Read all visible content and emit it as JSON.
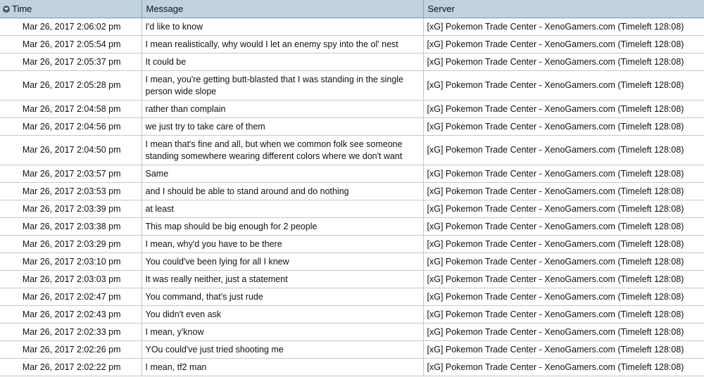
{
  "columns": {
    "time": "Time",
    "message": "Message",
    "server": "Server"
  },
  "rows": [
    {
      "time": "Mar 26, 2017 2:06:02 pm",
      "message": "I'd like to know",
      "server": "[xG] Pokemon Trade Center - XenoGamers.com (Timeleft 128:08)"
    },
    {
      "time": "Mar 26, 2017 2:05:54 pm",
      "message": "I mean realistically, why would I let an enemy spy into the ol' nest",
      "server": "[xG] Pokemon Trade Center - XenoGamers.com (Timeleft 128:08)"
    },
    {
      "time": "Mar 26, 2017 2:05:37 pm",
      "message": "It could be",
      "server": "[xG] Pokemon Trade Center - XenoGamers.com (Timeleft 128:08)"
    },
    {
      "time": "Mar 26, 2017 2:05:28 pm",
      "message": "I mean, you're getting butt-blasted that I was standing in the single person wide slope",
      "server": "[xG] Pokemon Trade Center - XenoGamers.com (Timeleft 128:08)"
    },
    {
      "time": "Mar 26, 2017 2:04:58 pm",
      "message": "rather than complain",
      "server": "[xG] Pokemon Trade Center - XenoGamers.com (Timeleft 128:08)"
    },
    {
      "time": "Mar 26, 2017 2:04:56 pm",
      "message": "we just try to take care of them",
      "server": "[xG] Pokemon Trade Center - XenoGamers.com (Timeleft 128:08)"
    },
    {
      "time": "Mar 26, 2017 2:04:50 pm",
      "message": "I mean that's fine and all, but when we common folk see someone standing somewhere wearing different colors where we don't want",
      "server": "[xG] Pokemon Trade Center - XenoGamers.com (Timeleft 128:08)"
    },
    {
      "time": "Mar 26, 2017 2:03:57 pm",
      "message": "Same",
      "server": "[xG] Pokemon Trade Center - XenoGamers.com (Timeleft 128:08)"
    },
    {
      "time": "Mar 26, 2017 2:03:53 pm",
      "message": "and I should be able to stand around and do nothing",
      "server": "[xG] Pokemon Trade Center - XenoGamers.com (Timeleft 128:08)"
    },
    {
      "time": "Mar 26, 2017 2:03:39 pm",
      "message": "at least",
      "server": "[xG] Pokemon Trade Center - XenoGamers.com (Timeleft 128:08)"
    },
    {
      "time": "Mar 26, 2017 2:03:38 pm",
      "message": "This map should be big enough for 2 people",
      "server": "[xG] Pokemon Trade Center - XenoGamers.com (Timeleft 128:08)"
    },
    {
      "time": "Mar 26, 2017 2:03:29 pm",
      "message": "I mean, why'd you have to be there",
      "server": "[xG] Pokemon Trade Center - XenoGamers.com (Timeleft 128:08)"
    },
    {
      "time": "Mar 26, 2017 2:03:10 pm",
      "message": "You could've been lying for all I knew",
      "server": "[xG] Pokemon Trade Center - XenoGamers.com (Timeleft 128:08)"
    },
    {
      "time": "Mar 26, 2017 2:03:03 pm",
      "message": "It was really neither, just a statement",
      "server": "[xG] Pokemon Trade Center - XenoGamers.com (Timeleft 128:08)"
    },
    {
      "time": "Mar 26, 2017 2:02:47 pm",
      "message": "You command, that's just rude",
      "server": "[xG] Pokemon Trade Center - XenoGamers.com (Timeleft 128:08)"
    },
    {
      "time": "Mar 26, 2017 2:02:43 pm",
      "message": "You didn't even ask",
      "server": "[xG] Pokemon Trade Center - XenoGamers.com (Timeleft 128:08)"
    },
    {
      "time": "Mar 26, 2017 2:02:33 pm",
      "message": "I mean, y'know",
      "server": "[xG] Pokemon Trade Center - XenoGamers.com (Timeleft 128:08)"
    },
    {
      "time": "Mar 26, 2017 2:02:26 pm",
      "message": "YOu could've just tried shooting me",
      "server": "[xG] Pokemon Trade Center - XenoGamers.com (Timeleft 128:08)"
    },
    {
      "time": "Mar 26, 2017 2:02:22 pm",
      "message": "I mean, tf2 man",
      "server": "[xG] Pokemon Trade Center - XenoGamers.com (Timeleft 128:08)"
    }
  ]
}
